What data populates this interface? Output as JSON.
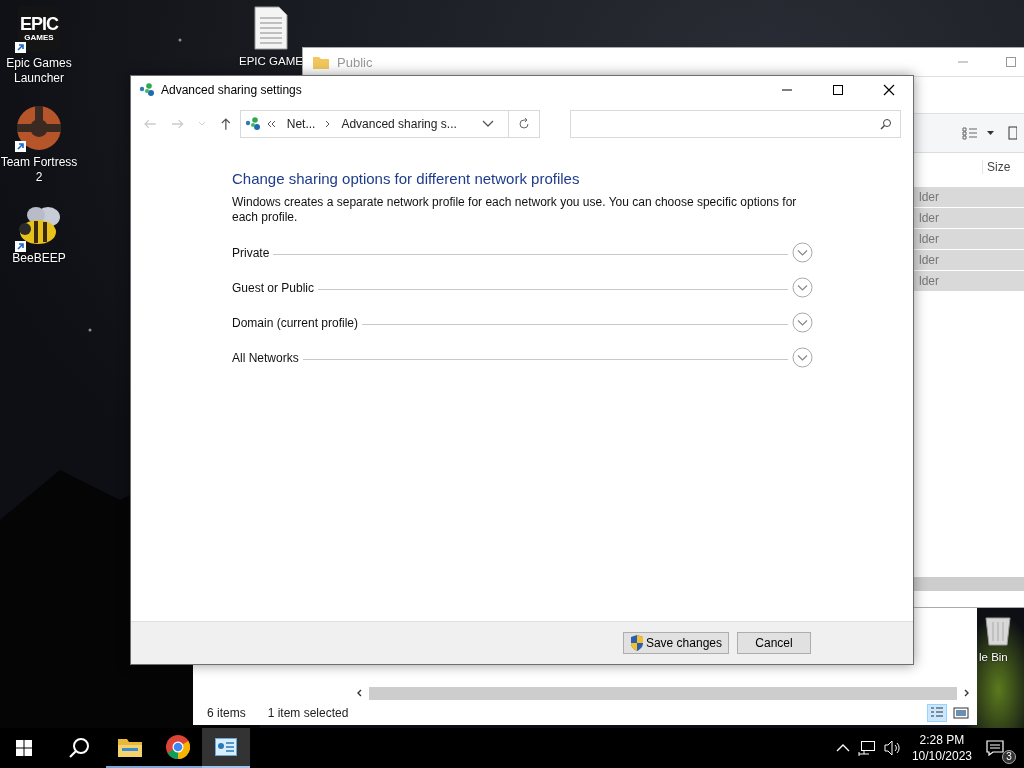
{
  "desktop": {
    "icons": [
      {
        "kind": "epic",
        "label": "Epic Games Launcher",
        "logo_text": [
          "EPIC",
          "GAMES"
        ]
      },
      {
        "kind": "tf",
        "label": "Team Fortress 2"
      },
      {
        "kind": "bee",
        "label": "BeeBEEP"
      },
      {
        "kind": "doc",
        "label": "EPIC GAME"
      },
      {
        "kind": "bin",
        "label": "le Bin"
      }
    ]
  },
  "explorer_back": {
    "status": {
      "count": "6 items",
      "selection": "1 item selected"
    }
  },
  "explorer_front": {
    "title": "Public",
    "column": "Size",
    "rows": [
      {
        "text": "lder",
        "selected": true
      },
      {
        "text": "lder",
        "selected": true
      },
      {
        "text": "lder",
        "selected": true
      },
      {
        "text": "lder",
        "selected": true
      },
      {
        "text": "lder",
        "selected": true
      }
    ]
  },
  "dialog": {
    "title": "Advanced sharing settings",
    "breadcrumb": [
      "Net...",
      "Advanced sharing s..."
    ],
    "heading": "Change sharing options for different network profiles",
    "description": "Windows creates a separate network profile for each network you use. You can choose specific options for each profile.",
    "profiles": [
      {
        "label": "Private",
        "expanded": false
      },
      {
        "label": "Guest or Public",
        "expanded": false
      },
      {
        "label": "Domain (current profile)",
        "expanded": false
      },
      {
        "label": "All Networks",
        "expanded": false
      }
    ],
    "buttons": [
      {
        "label": "Save changes",
        "kind": "shield"
      },
      {
        "label": "Cancel",
        "kind": "plain"
      }
    ]
  },
  "taskbar": {
    "apps": [
      {
        "kind": "explorer",
        "selected": false
      },
      {
        "kind": "browser",
        "selected": false
      },
      {
        "kind": "control",
        "selected": true
      }
    ],
    "time": "2:28 PM",
    "date": "10/10/2023",
    "notifications": "3"
  }
}
